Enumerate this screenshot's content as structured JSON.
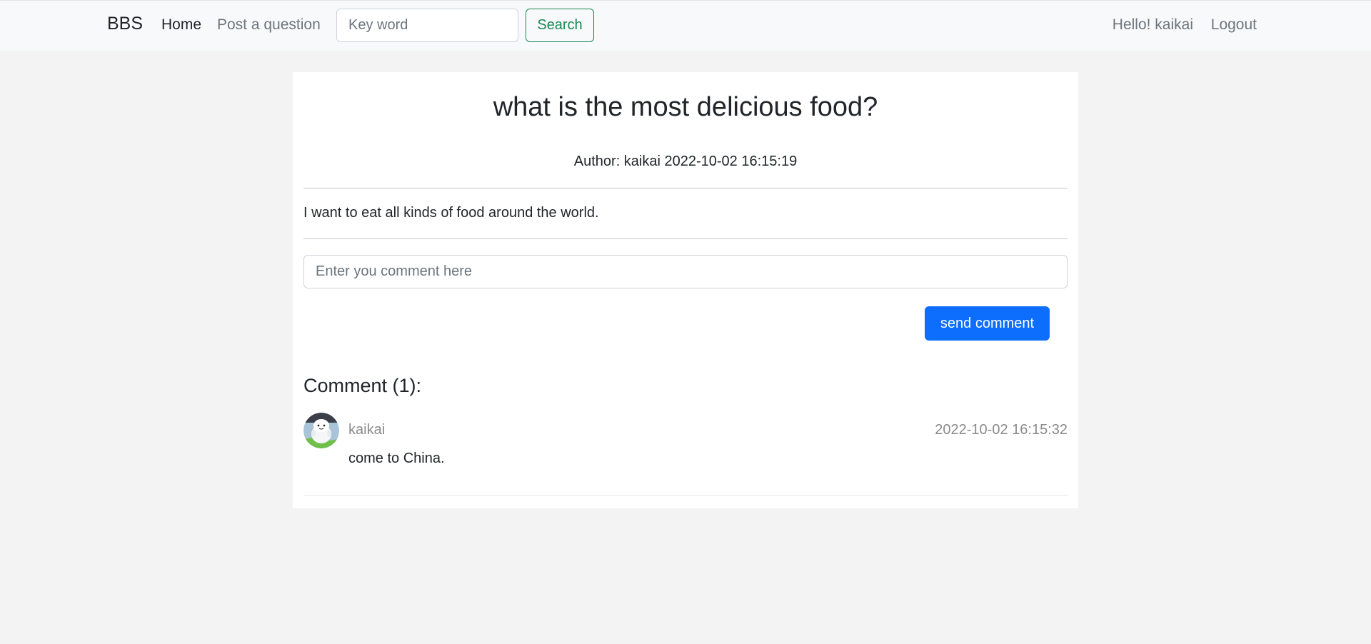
{
  "navbar": {
    "brand": "BBS",
    "links": {
      "home": "Home",
      "post": "Post a question"
    },
    "search": {
      "placeholder": "Key word",
      "value": "",
      "button_label": "Search"
    },
    "user": {
      "greeting": "Hello! kaikai",
      "logout": "Logout"
    }
  },
  "question": {
    "title": "what is the most delicious food?",
    "meta": "Author: kaikai 2022-10-02 16:15:19",
    "content": "I want to eat all kinds of food around the world."
  },
  "comment_form": {
    "placeholder": "Enter you comment here",
    "value": "",
    "button_label": "send comment"
  },
  "comments": {
    "heading": "Comment (1):",
    "items": [
      {
        "author": "kaikai",
        "time": "2022-10-02 16:15:32",
        "body": "come to China.",
        "avatar_icon": "avatar-cartoon-icon"
      }
    ]
  },
  "colors": {
    "navbar_bg": "#f8f9fa",
    "page_bg": "#f3f3f3",
    "search_button": "#198754",
    "primary_button": "#0d6efd",
    "muted_text": "#6c757d"
  }
}
